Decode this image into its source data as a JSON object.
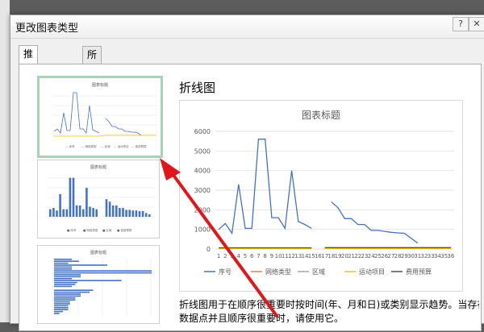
{
  "dialog": {
    "title": "更改图表类型",
    "tabs": [
      {
        "label": "推荐的图表",
        "active": true
      },
      {
        "label": "所有图表",
        "active": false
      }
    ]
  },
  "preview": {
    "type_name": "折线图",
    "description_line1": "折线图用于在顺序很重要时按时间(年、月和日)或类别显示趋势。当存在",
    "description_line2": "数据点并且顺序很重要时，请使用它。"
  },
  "thumbnails": [
    {
      "kind": "line",
      "title": "图表标题",
      "selected": true
    },
    {
      "kind": "column",
      "title": "图表标题",
      "selected": false
    },
    {
      "kind": "bar",
      "title": "图表标题",
      "selected": false
    }
  ],
  "chart_data": {
    "type": "line",
    "title": "图表标题",
    "ylim": [
      0,
      6000
    ],
    "yticks": [
      "0",
      "1000",
      "2000",
      "3000",
      "4000",
      "5000",
      "6000"
    ],
    "categories": [
      "1",
      "2",
      "3",
      "4",
      "5",
      "6",
      "7",
      "8",
      "9",
      "10",
      "11",
      "12",
      "13",
      "14",
      "15",
      "16",
      "17",
      "18",
      "19",
      "20",
      "21",
      "22",
      "23",
      "24",
      "25",
      "26",
      "27",
      "28",
      "29",
      "30",
      "31",
      "32",
      "33",
      "34",
      "35",
      "36"
    ],
    "series": [
      {
        "name": "序号",
        "color": "#4472c4",
        "values": [
          1000,
          1300,
          800,
          3300,
          1050,
          1050,
          5600,
          5600,
          1600,
          1600,
          1050,
          4000,
          1400,
          1250,
          1050,
          null,
          null,
          2400,
          2100,
          1550,
          1550,
          1250,
          1250,
          950,
          950,
          900,
          850,
          820,
          800,
          550,
          300,
          null,
          null,
          null,
          null,
          null
        ]
      },
      {
        "name": "网络类型",
        "color": "#ed7d31",
        "values": [
          30,
          30,
          30,
          30,
          30,
          30,
          30,
          30,
          30,
          30,
          30,
          30,
          30,
          30,
          30,
          null,
          40,
          40,
          40,
          40,
          40,
          40,
          40,
          40,
          40,
          40,
          40,
          40,
          40,
          40,
          40,
          40,
          40,
          40,
          40,
          40
        ]
      },
      {
        "name": "区域",
        "color": "#a5a5a5",
        "values": [
          50,
          50,
          50,
          50,
          50,
          50,
          50,
          50,
          50,
          50,
          50,
          50,
          50,
          50,
          50,
          null,
          60,
          60,
          60,
          60,
          60,
          60,
          60,
          60,
          60,
          60,
          60,
          60,
          60,
          60,
          60,
          60,
          60,
          60,
          60,
          60
        ]
      },
      {
        "name": "运动项目",
        "color": "#ffc000",
        "values": [
          20,
          20,
          20,
          20,
          20,
          20,
          20,
          20,
          20,
          20,
          20,
          20,
          20,
          20,
          20,
          null,
          30,
          30,
          30,
          30,
          30,
          30,
          30,
          30,
          30,
          30,
          30,
          30,
          30,
          30,
          30,
          30,
          30,
          30,
          30,
          30
        ]
      },
      {
        "name": "费用预算",
        "color": "#44546a",
        "values": [
          60,
          60,
          60,
          60,
          60,
          60,
          60,
          60,
          60,
          60,
          60,
          60,
          60,
          60,
          60,
          null,
          70,
          70,
          70,
          70,
          70,
          70,
          70,
          70,
          70,
          70,
          70,
          70,
          70,
          70,
          70,
          70,
          70,
          70,
          70,
          70
        ]
      }
    ]
  }
}
